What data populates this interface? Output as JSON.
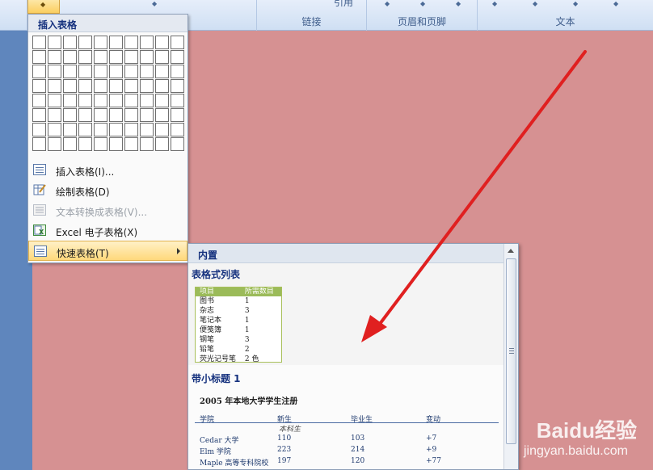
{
  "ribbon": {
    "groups": [
      {
        "label": ""
      },
      {
        "label": ""
      },
      {
        "label": "链接"
      },
      {
        "label": "页眉和页脚"
      },
      {
        "label": "文本"
      }
    ],
    "ref_text": "引用"
  },
  "insert_table_menu": {
    "title": "插入表格",
    "grid": {
      "columns": 10,
      "rows": 8
    },
    "items": [
      {
        "label": "插入表格(I)...",
        "icon": "table-grid-icon",
        "enabled": true
      },
      {
        "label": "绘制表格(D)",
        "icon": "draw-table-icon",
        "enabled": true
      },
      {
        "label": "文本转换成表格(V)...",
        "icon": "convert-text-icon",
        "enabled": false
      },
      {
        "label": "Excel 电子表格(X)",
        "icon": "excel-icon",
        "enabled": true
      },
      {
        "label": "快速表格(T)",
        "icon": "quick-table-icon",
        "enabled": true,
        "selected": true
      }
    ]
  },
  "quick_tables": {
    "header": "内置",
    "sections": [
      {
        "title": "表格式列表",
        "headers": [
          "项目",
          "所需数目"
        ],
        "rows": [
          [
            "图书",
            "1"
          ],
          [
            "杂志",
            "3"
          ],
          [
            "笔记本",
            "1"
          ],
          [
            "便笺簿",
            "1"
          ],
          [
            "钢笔",
            "3"
          ],
          [
            "铅笔",
            "2"
          ],
          [
            "荧光记号笔",
            "2 色"
          ]
        ]
      },
      {
        "title": "带小标题 1",
        "table_title": "2005 年本地大学学生注册",
        "headers": [
          "学院",
          "新生",
          "毕业生",
          "变动"
        ],
        "subheading": "本科生",
        "rows": [
          [
            "Cedar 大学",
            "110",
            "103",
            "+7"
          ],
          [
            "Elm 学院",
            "223",
            "214",
            "+9"
          ],
          [
            "Maple 高等专科院校",
            "197",
            "120",
            "+77"
          ]
        ]
      }
    ]
  },
  "watermark": {
    "brand": "Baidu经验",
    "sub": "jingyan.baidu.com"
  },
  "colors": {
    "document_bg": "#d69192",
    "arrow": "#e02020",
    "accent_header": "#9bbb59"
  }
}
